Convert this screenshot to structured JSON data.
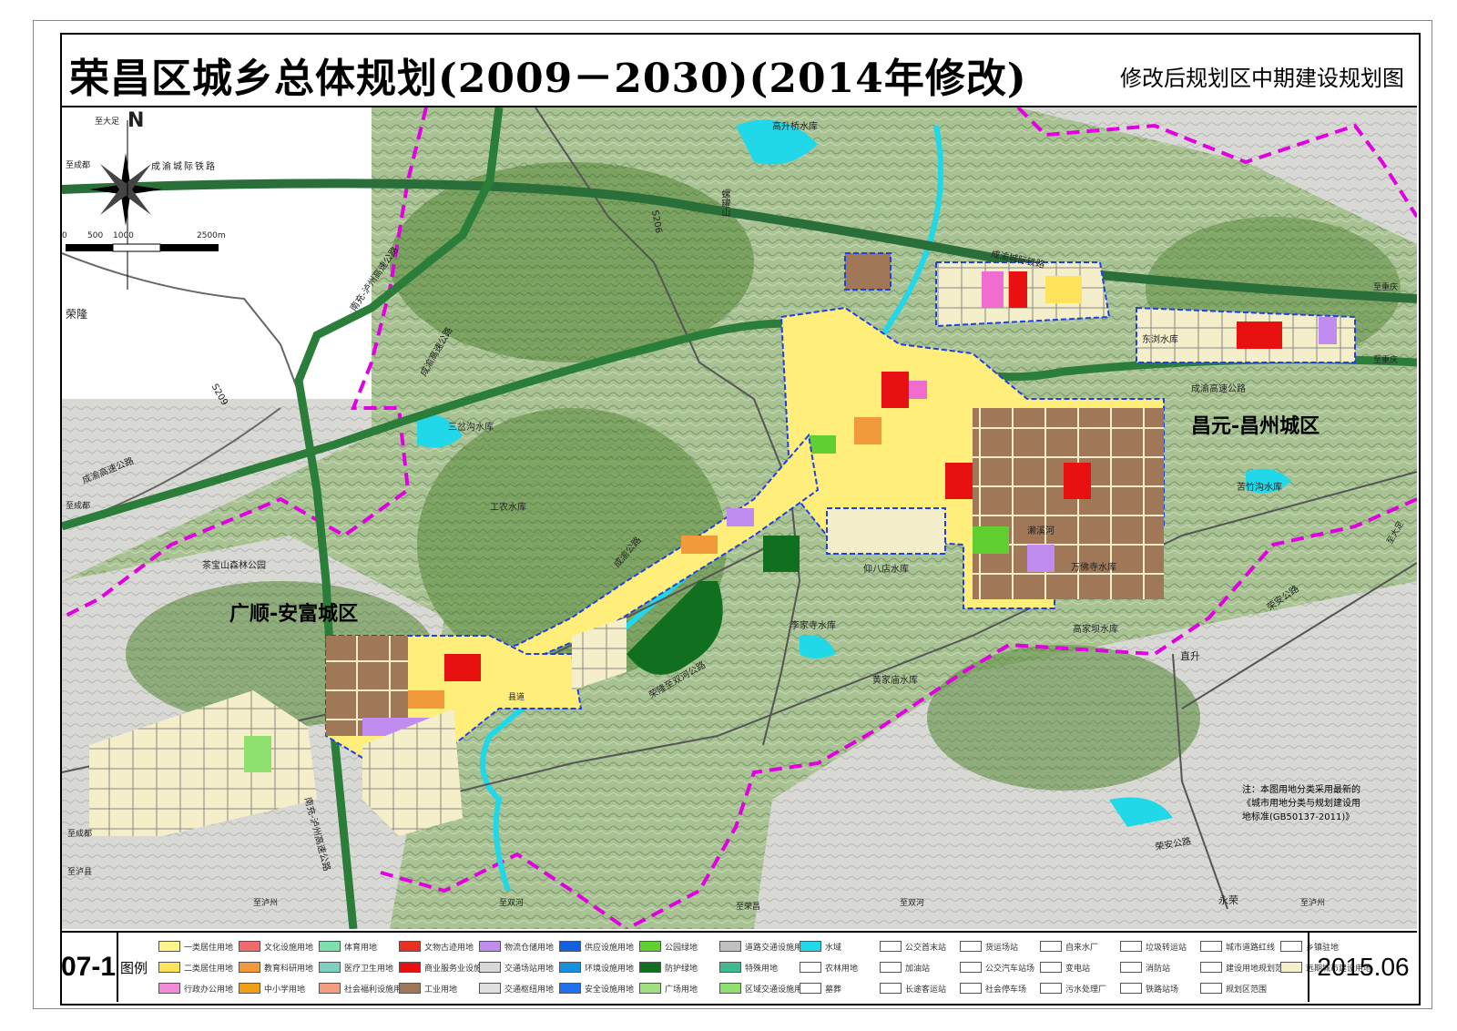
{
  "title": {
    "main": "荣昌区城乡总体规划(2009－2030)(2014年修改)",
    "sub": "修改后规划区中期建设规划图"
  },
  "code": "07-1",
  "date": "2015.06",
  "legend_title": "图例",
  "north_label": "N",
  "scale": {
    "ticks": [
      "0",
      "500",
      "1000",
      "2500m"
    ]
  },
  "districts": {
    "east": "昌元-昌州城区",
    "west": "广顺-安富城区"
  },
  "places": {
    "ronglong": "荣隆",
    "zhisheng": "直升",
    "yongrong": "永荣"
  },
  "labels": {
    "railway": "成渝城际铁路",
    "railway_short": "成渝城际铁路",
    "expressway": "成渝高速公路",
    "expressway_2": "成渝高速公路",
    "expressway_3": "成渝高速公路",
    "nanda": "南充-泸州高速公路",
    "nanda_2": "南充-泸州高速公路",
    "s206": "S206",
    "s209": "S209",
    "to_chengdu_1": "至成都",
    "to_chengdu_2": "至成都",
    "to_chengdu_3": "至成都",
    "to_dazu": "至大足",
    "to_dazu_2": "至大足",
    "to_luxian": "至泸县",
    "to_luxian_2": "至泸州",
    "to_luzhou": "至泸州",
    "to_shuanghe": "至双河",
    "to_shuanghe_2": "至双河",
    "to_chongqing": "至重庆",
    "to_chongqing_2": "至重庆",
    "to_xiaojia": "至荣昌",
    "gaoshengqiao": "高升桥水库",
    "sanchagou": "三岔沟水库",
    "gongshui": "工农水库",
    "dongzhen": "东浏水库",
    "kucai": "苦竹沟水库",
    "wanfo": "万佛寺水库",
    "yangbaiju": "仰八店水库",
    "lijiasi": "李家寺水库",
    "gaojiashan": "高家坝水库",
    "huojiamiao": "黄家庙水库",
    "chabao": "茶宝山森林公园",
    "laiyong": "濑溪河",
    "luoshan": "螺罐山",
    "ranqing": "县道",
    "chengyu_road": "成渝公路",
    "ronglong_road": "荣隆至双河公路",
    "fuan_road": "荣安公路",
    "nanda_road": "荣安公路"
  },
  "note": {
    "line1": "注：本图用地分类采用最新的",
    "line2": "《城市用地分类与规划建设用",
    "line3": "地标准(GB50137-2011)》"
  },
  "legend": [
    {
      "label": "一类居住用地",
      "color": "#fff58a"
    },
    {
      "label": "二类居住用地",
      "color": "#ffe35a"
    },
    {
      "label": "行政办公用地",
      "color": "#f08cd8"
    },
    {
      "label": "文化设施用地",
      "color": "#f06c6c"
    },
    {
      "label": "教育科研用地",
      "color": "#f09a3c"
    },
    {
      "label": "中小学用地",
      "color": "#f0a018"
    },
    {
      "label": "体育用地",
      "color": "#7fe0b0"
    },
    {
      "label": "医疗卫生用地",
      "color": "#7fd0c0"
    },
    {
      "label": "社会福利设施用地",
      "color": "#f0a080"
    },
    {
      "label": "文物古迹用地",
      "color": "#e83020"
    },
    {
      "label": "商业服务业设施用地",
      "color": "#e81010"
    },
    {
      "label": "工业用地",
      "color": "#a07858"
    },
    {
      "label": "物流仓储用地",
      "color": "#c08cf0"
    },
    {
      "label": "交通场站用地",
      "color": "#d8d8d8"
    },
    {
      "label": "交通枢纽用地",
      "color": "#e0e0e0"
    },
    {
      "label": "供应设施用地",
      "color": "#1060e0"
    },
    {
      "label": "环境设施用地",
      "color": "#1890e0"
    },
    {
      "label": "安全设施用地",
      "color": "#2070f0"
    },
    {
      "label": "公园绿地",
      "color": "#60d030"
    },
    {
      "label": "防护绿地",
      "color": "#107020"
    },
    {
      "label": "广场用地",
      "color": "#a0e080"
    },
    {
      "label": "道路交通设施用地",
      "color": "#c0c0c0"
    },
    {
      "label": "特殊用地",
      "color": "#40b890"
    },
    {
      "label": "区域交通设施用地",
      "color": "#90e070"
    },
    {
      "label": "水域",
      "color": "#20d8e8"
    },
    {
      "label": "农林用地",
      "color": "#ffffff"
    },
    {
      "label": "墓葬",
      "color": "#ffffff"
    },
    {
      "label": "公交首末站",
      "color": "#ffffff"
    },
    {
      "label": "加油站",
      "color": "#ffffff"
    },
    {
      "label": "长途客运站",
      "color": "#ffffff"
    },
    {
      "label": "货运场站",
      "color": "#ffffff"
    },
    {
      "label": "公交汽车站场",
      "color": "#ffffff"
    },
    {
      "label": "社会停车场",
      "color": "#ffffff"
    },
    {
      "label": "自来水厂",
      "color": "#ffffff"
    },
    {
      "label": "变电站",
      "color": "#ffffff"
    },
    {
      "label": "污水处理厂",
      "color": "#ffffff"
    },
    {
      "label": "垃圾转运站",
      "color": "#ffffff"
    },
    {
      "label": "消防站",
      "color": "#ffffff"
    },
    {
      "label": "铁路站场",
      "color": "#ffffff"
    },
    {
      "label": "城市道路红线",
      "color": "#ffffff"
    },
    {
      "label": "建设用地规划范围",
      "color": "#ffffff"
    },
    {
      "label": "规划区范围",
      "color": "#ffffff"
    },
    {
      "label": "乡镇驻地",
      "color": "#ffffff"
    },
    {
      "label": "远期城市建设用地",
      "color": "#f4eecb"
    }
  ]
}
